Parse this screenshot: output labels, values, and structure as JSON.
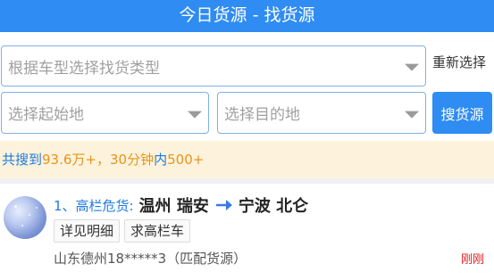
{
  "header": {
    "title": "今日货源 - 找货源"
  },
  "filters": {
    "type_placeholder": "根据车型选择找货类型",
    "reset_label": "重新选择",
    "origin_placeholder": "选择起始地",
    "dest_placeholder": "选择目的地",
    "search_label": "搜货源"
  },
  "stats": {
    "prefix": "共搜到",
    "count": "93.6万+",
    "middle": "，",
    "period": "30分钟",
    "within": "内",
    "recent": "500+"
  },
  "listings": [
    {
      "index_label": "1、高栏危货:",
      "from": "温州 瑞安",
      "to": "宁波 北仑",
      "tags": [
        "详见明细",
        "求高栏车"
      ],
      "contact": "山东德州18*****3（匹配货源）",
      "time": "刚刚"
    }
  ],
  "colors": {
    "primary": "#2f8cf2",
    "stats_bg": "#fdf3dc",
    "highlight_orange": "#e8941a",
    "time_red": "#e02020"
  }
}
